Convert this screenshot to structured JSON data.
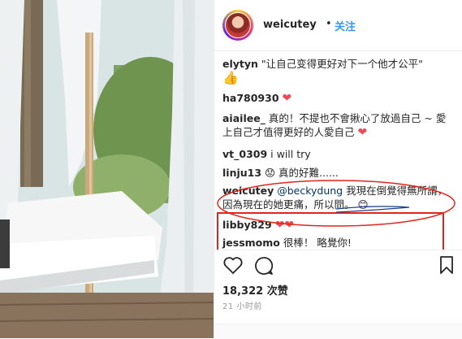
{
  "post": {
    "username": "weicutey",
    "separator": "•",
    "follow_label": "关注"
  },
  "comments": [
    {
      "user": "elytyn",
      "text": "\"让自己变得更好对下一个他才公平\"",
      "emoji": "👍"
    },
    {
      "user": "ha780930",
      "text": "",
      "emoji": "❤"
    },
    {
      "user": "aiailee_",
      "text": "真的！不提也不會揪心了放過自己 ~ 愛上自己才值得更好的人愛自己",
      "emoji": "❤"
    },
    {
      "user": "vt_0309",
      "text": "i will try",
      "emoji": ""
    },
    {
      "user": "linju13",
      "text": "真的好難......",
      "emoji": "😟"
    },
    {
      "user": "weicutey",
      "mention": "@beckydung",
      "text": "我現在倒覺得無所謂，因為現在的她更痛，所以問。",
      "emoji": "😊"
    },
    {
      "user": "libby829",
      "text": "",
      "emoji": "❤❤"
    },
    {
      "user": "jessmomo",
      "text": "很棒！ 略覺你!",
      "emoji": ""
    }
  ],
  "actions": {
    "like_icon": "heart-outline-icon",
    "comment_icon": "comment-bubble-icon",
    "save_icon": "bookmark-icon"
  },
  "likes_text": "18,322 次赞",
  "time_text": "21 小时前"
}
